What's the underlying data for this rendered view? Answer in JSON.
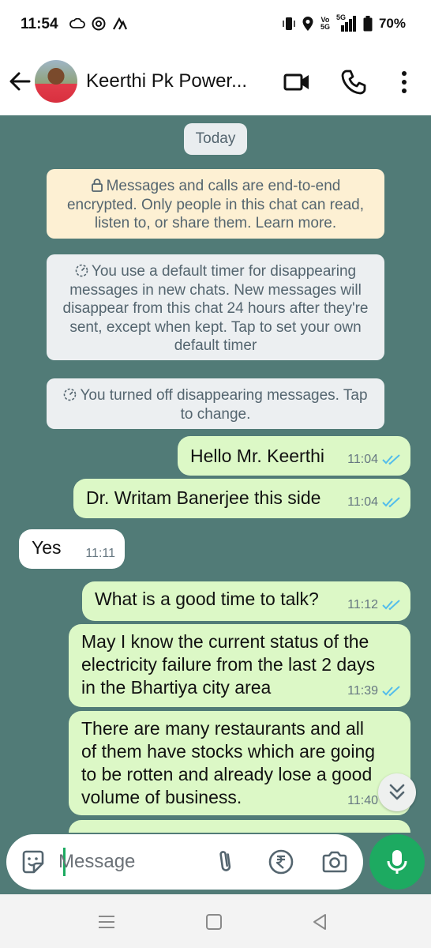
{
  "status_bar": {
    "time": "11:54",
    "network_label_top": "Vo",
    "network_label_bottom": "5G",
    "signal_label": "5G",
    "battery": "70%",
    "icons": [
      "cloud-icon",
      "app-icon",
      "app-icon",
      "vibrate-icon",
      "location-icon",
      "signal-icon",
      "battery-icon"
    ]
  },
  "header": {
    "contact_name": "Keerthi Pk Power...",
    "icons": [
      "back-arrow-icon",
      "video-call-icon",
      "phone-icon",
      "more-vertical-icon"
    ]
  },
  "chat": {
    "date_chip": "Today",
    "system_messages": [
      {
        "icon": "lock-icon",
        "text": "Messages and calls are end-to-end encrypted. Only people in this chat can read, listen to, or share them. Learn more."
      },
      {
        "icon": "timer-icon",
        "text": "You use a default timer for disappearing messages in new chats. New messages will disappear from this chat 24 hours after they're sent, except when kept. Tap to set your own default timer"
      },
      {
        "icon": "timer-icon",
        "text": "You turned off disappearing messages. Tap to change."
      }
    ],
    "messages": [
      {
        "direction": "outgoing",
        "lines": [
          "Hello Mr. Keerthi"
        ],
        "time": "11:04",
        "status": "read"
      },
      {
        "direction": "outgoing",
        "lines": [
          "Dr. Writam Banerjee this side"
        ],
        "time": "11:04",
        "status": "read"
      },
      {
        "direction": "incoming",
        "lines": [
          "Yes"
        ],
        "time": "11:11"
      },
      {
        "direction": "outgoing",
        "lines": [
          "What is a good time to talk?"
        ],
        "time": "11:12",
        "status": "read"
      },
      {
        "direction": "outgoing",
        "lines": [
          "May I know the current status of the",
          "electricity failure from the last 2 days",
          "in the Bhartiya city area"
        ],
        "time": "11:39",
        "status": "read"
      },
      {
        "direction": "outgoing",
        "lines": [
          "There are many restaurants and all",
          "of them have stocks which are going",
          "to be rotten and already lose a good",
          "volume of business."
        ],
        "time": "11:40",
        "status": "read"
      }
    ]
  },
  "composer": {
    "placeholder": "Message",
    "icons": [
      "sticker-icon",
      "attach-icon",
      "rupee-payment-icon",
      "camera-icon",
      "mic-icon"
    ]
  },
  "colors": {
    "chat_background": "#517b77",
    "outgoing_bubble": "#dcf8c6",
    "incoming_bubble": "#ffffff",
    "read_ticks": "#53bdeb",
    "accent_green": "#1daa61",
    "encryption_notice": "#fdf0d3"
  }
}
